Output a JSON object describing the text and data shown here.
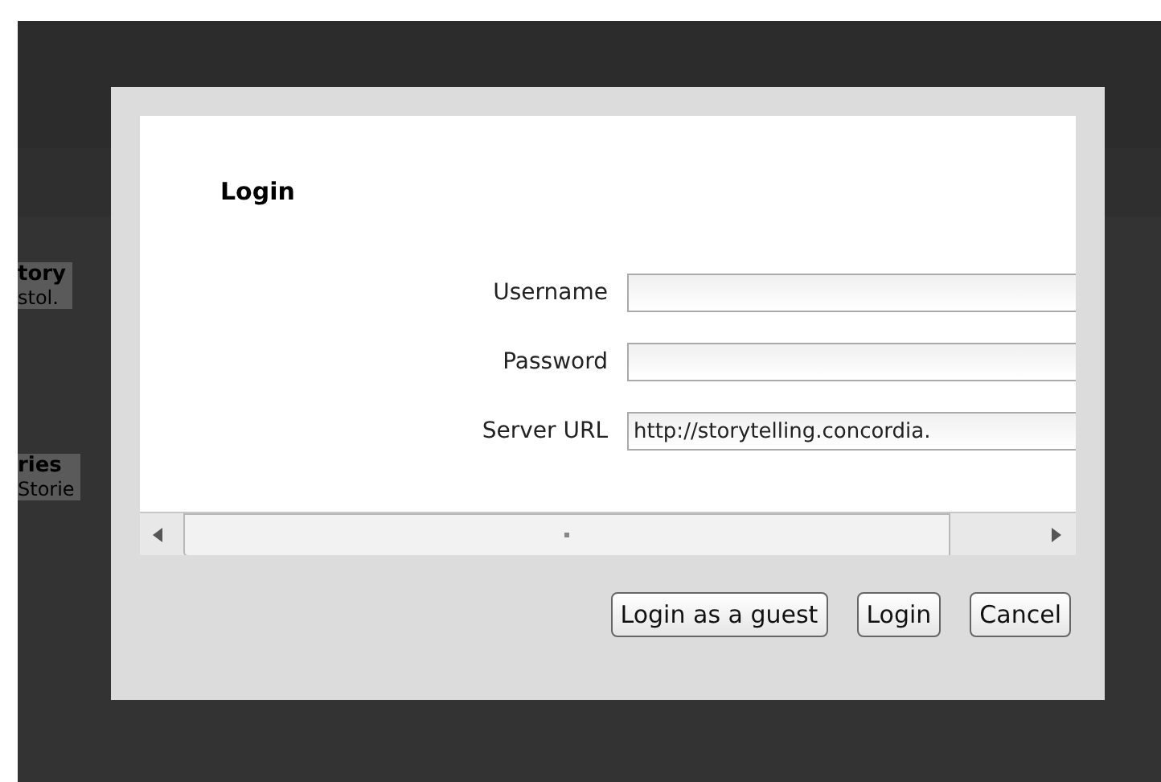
{
  "background": {
    "items": [
      {
        "title": "tory",
        "subtitle": "stol."
      },
      {
        "title": "ries",
        "subtitle": "Storie"
      }
    ]
  },
  "dialog": {
    "title": "Login",
    "fields": [
      {
        "label": "Username"
      },
      {
        "label": "Password"
      },
      {
        "label": "Server URL",
        "value": "http://storytelling.concordia."
      }
    ],
    "buttons": [
      "Login as a guest",
      "Login",
      "Cancel"
    ]
  }
}
